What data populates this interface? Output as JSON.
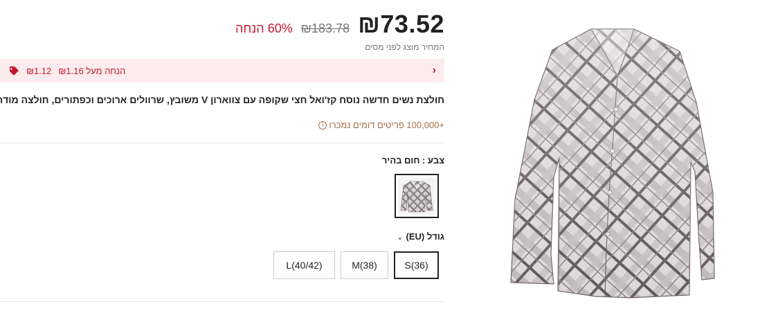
{
  "price": {
    "current": "₪73.52",
    "original": "₪183.78",
    "discount": "60% הנחה",
    "tax_note": "המחיר מוצג לפני מסים"
  },
  "coupon": {
    "amount": "₪1.12",
    "text": "הנחה מעל ₪1.16",
    "icon": "tag-icon",
    "chevron": "›"
  },
  "product": {
    "title": "חולצת נשים חדשה נוסח קז'ואל חצי שקופה עם צווארון V משובץ, שרוולים ארוכים וכפתורים, חולצה מודרנית",
    "sold": "+100,000 פריטים דומים נמכרו",
    "sold_icon": "info-icon"
  },
  "color": {
    "label": "צבע : חום בהיר",
    "swatch_name": "חום בהיר"
  },
  "size": {
    "label": "גודל (EU)",
    "caret": "⌄",
    "options": [
      "S(36)",
      "M(38)",
      "L(40/42)"
    ],
    "selected": "S(36)"
  },
  "colors": {
    "accent_red": "#c4172c",
    "coupon_bg": "#fdecee",
    "sold_brown": "#a5704a"
  }
}
